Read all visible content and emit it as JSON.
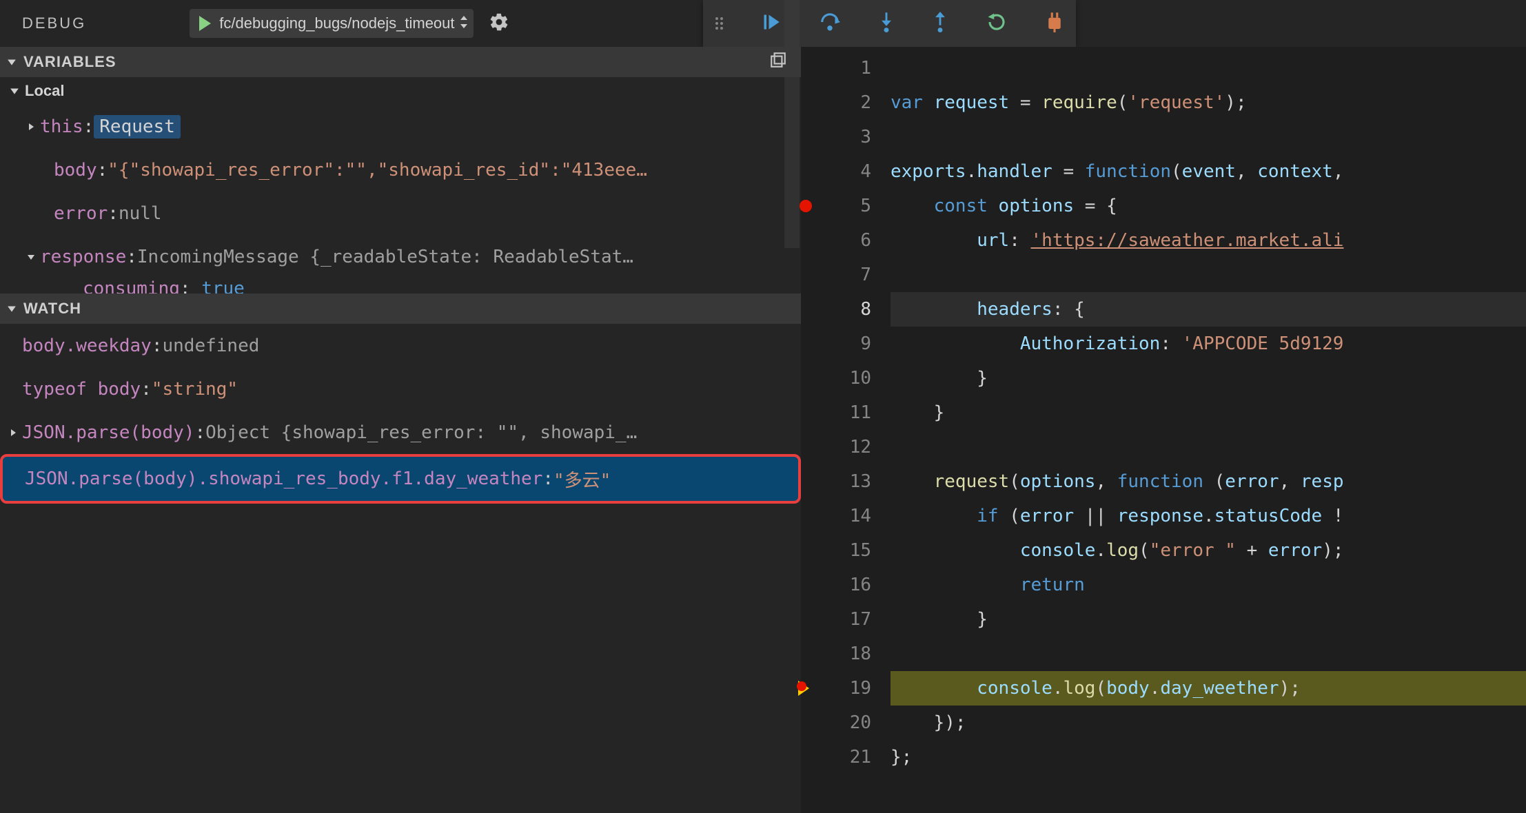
{
  "topbar": {
    "title": "DEBUG",
    "launch_config": "fc/debugging_bugs/nodejs_timeout"
  },
  "debug_tools": {
    "continue": "continue",
    "step_over": "step-over",
    "step_into": "step-into",
    "step_out": "step-out",
    "restart": "restart",
    "stop": "disconnect"
  },
  "sections": {
    "variables_title": "VARIABLES",
    "local_title": "Local",
    "watch_title": "WATCH"
  },
  "variables": {
    "local": [
      {
        "name": "this",
        "value_type": "Request",
        "expandable": true,
        "highlight": true
      },
      {
        "name": "body",
        "value": "\"{\"showapi_res_error\":\"\",\"showapi_res_id\":\"413eee…",
        "is_string": true
      },
      {
        "name": "error",
        "value": "null",
        "is_null": true
      },
      {
        "name": "response",
        "preview": "IncomingMessage {_readableState: ReadableStat…",
        "expandable": true,
        "expanded": true
      }
    ],
    "truncated_child": {
      "name": "consuming",
      "value": "true"
    }
  },
  "watch": [
    {
      "expr": "body.weekday",
      "value": "undefined",
      "kind": "undef"
    },
    {
      "expr": "typeof body",
      "value": "\"string\"",
      "kind": "string"
    },
    {
      "expr": "JSON.parse(body)",
      "value": "Object {showapi_res_error: \"\", showapi_…",
      "kind": "object",
      "expandable": true
    },
    {
      "expr": "JSON.parse(body).showapi_res_body.f1.day_weather",
      "value": "\"多云\"",
      "kind": "string",
      "selected": true
    }
  ],
  "editor": {
    "lines": [
      {
        "n": 1,
        "segs": []
      },
      {
        "n": 2,
        "segs": [
          [
            "kw",
            "var "
          ],
          [
            "var",
            "request"
          ],
          [
            "punc",
            " = "
          ],
          [
            "fn",
            "require"
          ],
          [
            "punc",
            "("
          ],
          [
            "str",
            "'request'"
          ],
          [
            "punc",
            ");"
          ]
        ]
      },
      {
        "n": 3,
        "segs": []
      },
      {
        "n": 4,
        "segs": [
          [
            "var",
            "exports"
          ],
          [
            "punc",
            "."
          ],
          [
            "var",
            "handler"
          ],
          [
            "punc",
            " = "
          ],
          [
            "kw",
            "function"
          ],
          [
            "punc",
            "("
          ],
          [
            "var",
            "event"
          ],
          [
            "punc",
            ", "
          ],
          [
            "var",
            "context"
          ],
          [
            "punc",
            ","
          ]
        ]
      },
      {
        "n": 5,
        "bp": true,
        "indent": 1,
        "segs": [
          [
            "kw",
            "const "
          ],
          [
            "var",
            "options"
          ],
          [
            "punc",
            " = {"
          ]
        ]
      },
      {
        "n": 6,
        "indent": 2,
        "segs": [
          [
            "var",
            "url"
          ],
          [
            "punc",
            ": "
          ],
          [
            "url",
            "'https://saweather.market.ali"
          ]
        ]
      },
      {
        "n": 7,
        "indent": 2,
        "segs": []
      },
      {
        "n": 8,
        "indent": 2,
        "hl": true,
        "segs": [
          [
            "var",
            "headers"
          ],
          [
            "punc",
            ": {"
          ]
        ]
      },
      {
        "n": 9,
        "indent": 3,
        "segs": [
          [
            "var",
            "Authorization"
          ],
          [
            "punc",
            ": "
          ],
          [
            "str",
            "'APPCODE 5d9129"
          ]
        ]
      },
      {
        "n": 10,
        "indent": 2,
        "segs": [
          [
            "punc",
            "}"
          ]
        ]
      },
      {
        "n": 11,
        "indent": 1,
        "segs": [
          [
            "punc",
            "}"
          ]
        ]
      },
      {
        "n": 12,
        "segs": []
      },
      {
        "n": 13,
        "indent": 1,
        "segs": [
          [
            "fn",
            "request"
          ],
          [
            "punc",
            "("
          ],
          [
            "var",
            "options"
          ],
          [
            "punc",
            ", "
          ],
          [
            "kw",
            "function"
          ],
          [
            "punc",
            " ("
          ],
          [
            "var",
            "error"
          ],
          [
            "punc",
            ", "
          ],
          [
            "var",
            "resp"
          ]
        ]
      },
      {
        "n": 14,
        "indent": 2,
        "segs": [
          [
            "kw",
            "if"
          ],
          [
            "punc",
            " ("
          ],
          [
            "var",
            "error"
          ],
          [
            "punc",
            " || "
          ],
          [
            "var",
            "response"
          ],
          [
            "punc",
            "."
          ],
          [
            "var",
            "statusCode"
          ],
          [
            "punc",
            " !"
          ]
        ]
      },
      {
        "n": 15,
        "indent": 3,
        "segs": [
          [
            "var",
            "console"
          ],
          [
            "punc",
            "."
          ],
          [
            "fn",
            "log"
          ],
          [
            "punc",
            "("
          ],
          [
            "str",
            "\"error \""
          ],
          [
            "punc",
            " + "
          ],
          [
            "var",
            "error"
          ],
          [
            "punc",
            ");"
          ]
        ]
      },
      {
        "n": 16,
        "indent": 3,
        "segs": [
          [
            "kw",
            "return"
          ]
        ]
      },
      {
        "n": 17,
        "indent": 2,
        "segs": [
          [
            "punc",
            "}"
          ]
        ]
      },
      {
        "n": 18,
        "segs": []
      },
      {
        "n": 19,
        "indent": 2,
        "exec": true,
        "curbp": true,
        "segs": [
          [
            "var",
            "console"
          ],
          [
            "punc",
            "."
          ],
          [
            "fn",
            "log"
          ],
          [
            "punc",
            "("
          ],
          [
            "var",
            "body"
          ],
          [
            "punc",
            "."
          ],
          [
            "var",
            "day_weether"
          ],
          [
            "punc",
            ");"
          ]
        ]
      },
      {
        "n": 20,
        "indent": 1,
        "segs": [
          [
            "punc",
            "});"
          ]
        ]
      },
      {
        "n": 21,
        "segs": [
          [
            "punc",
            "};"
          ]
        ]
      }
    ]
  }
}
